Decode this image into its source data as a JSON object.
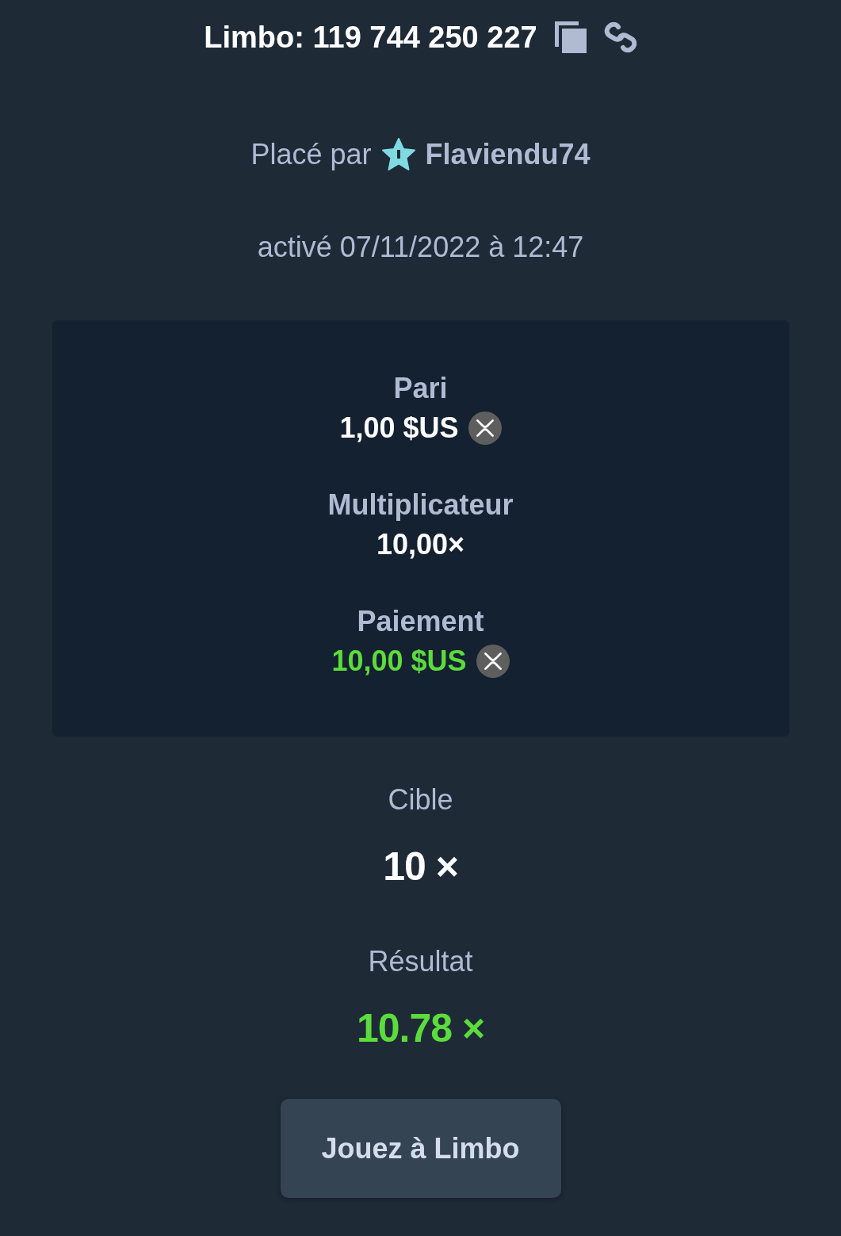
{
  "title": "Limbo: 119 744 250 227",
  "placed_by": {
    "label": "Placé par",
    "user": "Flaviendu74"
  },
  "activated": "activé 07/11/2022 à 12:47",
  "summary": [
    {
      "label": "Pari",
      "value": "1,00 $US",
      "kind": "currency",
      "win": false
    },
    {
      "label": "Multiplicateur",
      "value": "10,00×",
      "kind": "plain",
      "win": false
    },
    {
      "label": "Paiement",
      "value": "10,00 $US",
      "kind": "currency",
      "win": true
    }
  ],
  "target": {
    "label": "Cible",
    "value": "10 ×",
    "win": false
  },
  "result": {
    "label": "Résultat",
    "value": "10.78 ×",
    "win": true
  },
  "button": "Jouez à Limbo"
}
